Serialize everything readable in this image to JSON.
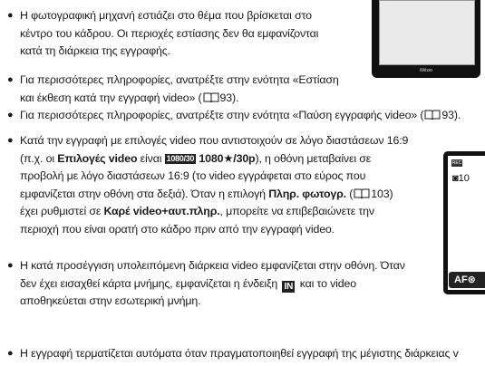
{
  "bullets": [
    {
      "lines": [
        "Η φωτογραφική μηχανή εστιάζει στο θέμα που βρίσκεται στο",
        "κέντρο του κάδρου. Οι περιοχές εστίασης δεν θα εμφανίζονται",
        "κατά τη διάρκεια της εγγραφής."
      ]
    },
    {
      "line1": "Για περισσότερες πληροφορίες, ανατρέξτε στην ενότητα «Εστίαση",
      "line2_pre": "και έκθεση κατά την εγγραφή video» (",
      "line2_post": "93)."
    },
    {
      "pre": "Για περισσότερες πληροφορίες, ανατρέξτε στην ενότητα «Παύση εγγραφής video» (",
      "post": "93)."
    },
    {
      "line1": "Κατά την εγγραφή με επιλογές video που αντιστοιχούν σε λόγο διαστάσεων 16:9",
      "line2_a": "(π.χ. οι ",
      "line2_b": "Επιλογές video",
      "line2_c": " είναι ",
      "line2_icon": "1080/30",
      "line2_d": "1080★/30p",
      "line2_e": "), η οθόνη μεταβαίνει σε",
      "line3": "προβολή με λόγο διαστάσεων 16:9 (το video εγγράφεται στο εύρος που",
      "line4_pre": "εμφανίζεται στην οθόνη στα δεξιά). Όταν η επιλογή ",
      "line4_b": "Πληρ. φωτογρ.",
      "line4_mid": " (",
      "line4_post": "103)",
      "line5_pre": "έχει ρυθμιστεί σε ",
      "line5_b": "Καρέ video+αυτ.πληρ.",
      "line5_post": ", μπορείτε να επιβεβαιώνετε την",
      "line6": "περιοχή που είναι ορατή στο κάδρο πριν από την εγγραφή video."
    },
    {
      "line1": "Η κατά προσέγγιση υπολειπόμενη διάρκεια video εμφανίζεται στην οθόνη. Όταν",
      "line2_pre": "δεν έχει εισαχθεί κάρτα μνήμης, εμφανίζεται η ένδειξη ",
      "line2_icon": "IN",
      "line2_post": " και το video",
      "line3": "αποθηκεύεται στην εσωτερική μνήμη."
    },
    {
      "line1": "Η εγγραφή τερματίζεται αυτόματα όταν πραγματοποιηθεί εγγραφή της μέγιστης διάρκειας v"
    }
  ],
  "camera_top": {
    "brand": "Nikon"
  },
  "camera_right": {
    "rec_badge": "REC",
    "count": "10",
    "af_label": "AF"
  }
}
